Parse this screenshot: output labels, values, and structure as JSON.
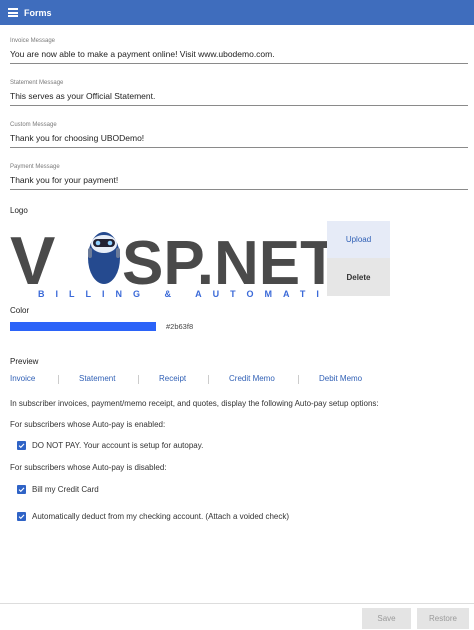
{
  "header": {
    "title": "Forms",
    "menu_icon": "hamburger-menu-icon"
  },
  "fields": [
    {
      "label": "Invoice Message",
      "value": "You are now able to make a payment online! Visit www.ubodemo.com."
    },
    {
      "label": "Statement Message",
      "value": "This serves as your Official Statement."
    },
    {
      "label": "Custom Message",
      "value": "Thank you for choosing UBODemo!"
    },
    {
      "label": "Payment Message",
      "value": "Thank you for your payment!"
    }
  ],
  "logo": {
    "label": "Logo",
    "brand_text_left": "V",
    "brand_text_right": "SP.NET",
    "tagline": "BILLING & AUTOMATION",
    "upload_label": "Upload",
    "delete_label": "Delete"
  },
  "color": {
    "label": "Color",
    "hex": "#2b63f8",
    "swatch": "#2b63f8"
  },
  "preview": {
    "label": "Preview",
    "links": [
      "Invoice",
      "Statement",
      "Receipt",
      "Credit Memo",
      "Debit Memo"
    ]
  },
  "autopay": {
    "intro": "In subscriber invoices, payment/memo receipt, and quotes, display the following Auto-pay setup options:",
    "enabled_heading": "For subscribers whose Auto-pay is enabled:",
    "enabled_option": "DO NOT PAY. Your account is setup for autopay.",
    "disabled_heading": "For subscribers whose Auto-pay is disabled:",
    "disabled_options": [
      "Bill my Credit Card",
      "Automatically deduct from my checking account. (Attach a voided check)"
    ]
  },
  "footer": {
    "save_label": "Save",
    "restore_label": "Restore"
  },
  "colors": {
    "header_bg": "#3f6dbd",
    "link": "#2f5fb5",
    "checkbox": "#2f63c6"
  }
}
